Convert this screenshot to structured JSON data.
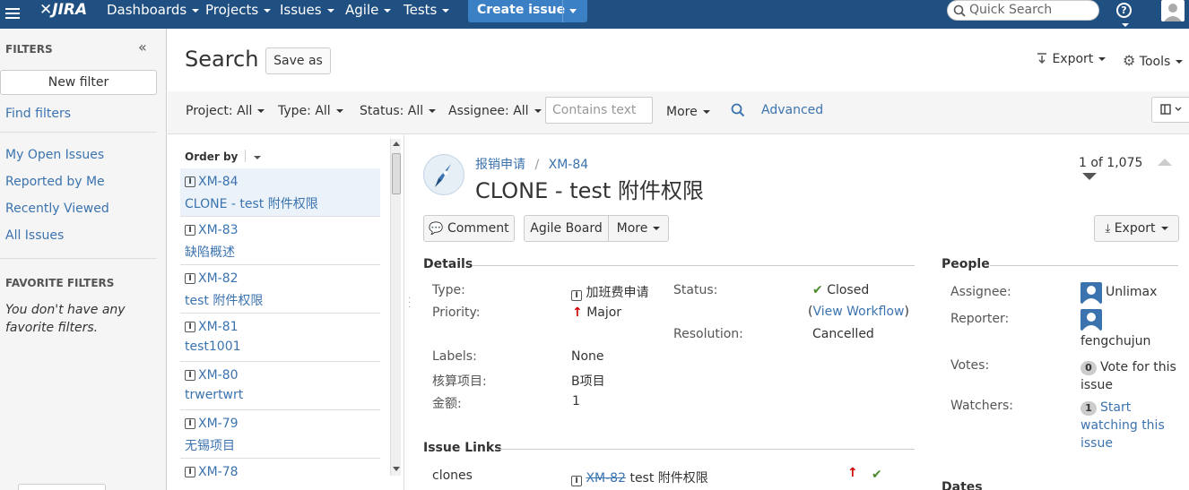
{
  "topbar": {
    "logo": "JIRA",
    "nav": [
      "Dashboards",
      "Projects",
      "Issues",
      "Agile",
      "Tests"
    ],
    "create_label": "Create issue",
    "search_placeholder": "Quick Search",
    "help_label": "?"
  },
  "sidebar": {
    "filters_heading": "FILTERS",
    "collapse_label": "«",
    "new_filter_label": "New filter",
    "find_filters": "Find filters",
    "links": [
      "My Open Issues",
      "Reported by Me",
      "Recently Viewed",
      "All Issues"
    ],
    "favorite_heading": "FAVORITE FILTERS",
    "favorite_empty": "You don't have any favorite filters."
  },
  "header": {
    "title": "Search",
    "save_as": "Save as",
    "export": "Export",
    "tools": "Tools"
  },
  "filterbar": {
    "project": "Project: All",
    "type": "Type: All",
    "status": "Status: All",
    "assignee": "Assignee: All",
    "contains_placeholder": "Contains text",
    "more": "More",
    "advanced": "Advanced"
  },
  "list": {
    "order_by": "Order by",
    "issues": [
      {
        "key": "XM-84",
        "summary": "CLONE - test 附件权限",
        "selected": true
      },
      {
        "key": "XM-83",
        "summary": "缺陷概述"
      },
      {
        "key": "XM-82",
        "summary": "test 附件权限"
      },
      {
        "key": "XM-81",
        "summary": "test1001"
      },
      {
        "key": "XM-80",
        "summary": "trwertwrt"
      },
      {
        "key": "XM-79",
        "summary": "无锡项目"
      },
      {
        "key": "XM-78",
        "summary": ""
      }
    ]
  },
  "issue": {
    "project": "报销申请",
    "separator": "/",
    "key": "XM-84",
    "title": "CLONE - test 附件权限",
    "pager": "1 of 1,075",
    "buttons": {
      "comment": "Comment",
      "agile_board": "Agile Board",
      "more": "More",
      "export": "Export"
    },
    "details_heading": "Details",
    "details": {
      "type_label": "Type:",
      "type_value": "加班费申请",
      "priority_label": "Priority:",
      "priority_value": "Major",
      "status_label": "Status:",
      "status_value": "Closed",
      "view_workflow": "View Workflow",
      "resolution_label": "Resolution:",
      "resolution_value": "Cancelled",
      "labels_label": "Labels:",
      "labels_value": "None",
      "accounting_label": "核算项目:",
      "accounting_value": "B项目",
      "amount_label": "金额:",
      "amount_value": "1"
    },
    "links_heading": "Issue Links",
    "links": {
      "relation": "clones",
      "linked_key": "XM-82",
      "linked_summary": "test 附件权限"
    },
    "people_heading": "People",
    "people": {
      "assignee_label": "Assignee:",
      "assignee": "Unlimax",
      "reporter_label": "Reporter:",
      "reporter": "fengchujun",
      "votes_label": "Votes:",
      "votes_count": "0",
      "votes_text": "Vote for this issue",
      "watchers_label": "Watchers:",
      "watchers_count": "1",
      "watchers_text": "Start watching this issue"
    },
    "dates_heading": "Dates"
  },
  "colors": {
    "topbar": "#205081",
    "link": "#3b73af",
    "create": "#3b7fc4",
    "priority": "#cc0000"
  }
}
